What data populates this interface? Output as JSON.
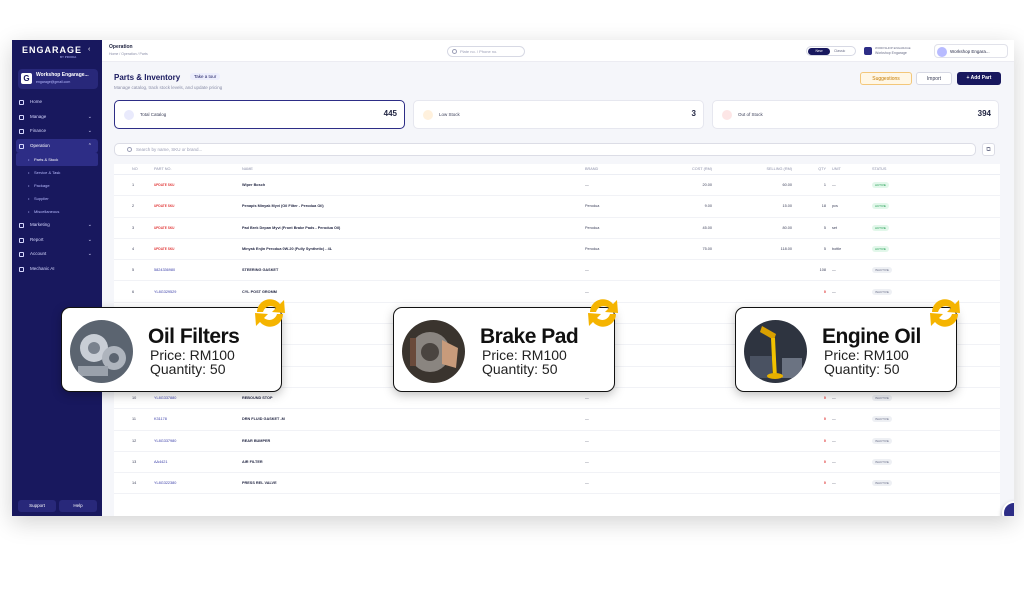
{
  "sidebar": {
    "logo": "ENGARAGE",
    "logo_sub": "BY PROIDA",
    "workshop_name": "Workshop Engarage...",
    "workshop_email": "engarage@gmail.com",
    "items": [
      {
        "label": "Home"
      },
      {
        "label": "Manage"
      },
      {
        "label": "Finance"
      },
      {
        "label": "Operation"
      },
      {
        "label": "Parts & Stock"
      },
      {
        "label": "Service & Task"
      },
      {
        "label": "Package"
      },
      {
        "label": "Supplier"
      },
      {
        "label": "Miscellaneous"
      },
      {
        "label": "Marketing"
      },
      {
        "label": "Report"
      },
      {
        "label": "Account"
      },
      {
        "label": "Mechanic AI"
      }
    ],
    "support": "Support",
    "help": "Help"
  },
  "topbar": {
    "title": "Operation",
    "breadcrumb": "Home / Operation / Parts",
    "search_placeholder": "Plate no. / Phone no.",
    "toggle_new": "New",
    "toggle_classic": "Classic",
    "account_label": "WORKSHOP ENGARAGE",
    "account_sub": "Workshop Engarage",
    "user": "Workshop Engara..."
  },
  "page": {
    "title": "Parts & Inventory",
    "tour": "Take a tour",
    "subtitle": "Manage catalog, track stock levels, and update pricing",
    "suggestions": "Suggestions",
    "import": "Import",
    "add_part": "+ Add Part"
  },
  "stats": {
    "total_label": "Total Catalog",
    "total_value": "445",
    "low_label": "Low Stock",
    "low_value": "3",
    "out_label": "Out of Stock",
    "out_value": "394"
  },
  "search": {
    "placeholder": "Search by name, SKU or brand..."
  },
  "table": {
    "headers": {
      "no": "NO",
      "part": "PART NO.",
      "name": "NAME",
      "brand": "BRAND",
      "cost": "COST (RM)",
      "sell": "SELLING (RM)",
      "qty": "QTY",
      "unit": "UNIT",
      "status": "STATUS"
    },
    "rows": [
      {
        "no": "1",
        "part": "UPDATE SKU",
        "name": "Wiper Bosch",
        "brand": "—",
        "cost": "20.00",
        "sell": "60.00",
        "qty": "1",
        "unit": "—",
        "status": "ACTIVE"
      },
      {
        "no": "2",
        "part": "UPDATE SKU",
        "name": "Penapis Minyak Myvi (Oil Filter - Perodua Oil)",
        "brand": "Perodua",
        "cost": "9.00",
        "sell": "15.00",
        "qty": "18",
        "unit": "pcs",
        "status": "ACTIVE"
      },
      {
        "no": "3",
        "part": "UPDATE SKU",
        "name": "Pad Brek Depan Myvi (Front Brake Pads - Perodua Oil)",
        "brand": "Perodua",
        "cost": "45.00",
        "sell": "80.00",
        "qty": "5",
        "unit": "set",
        "status": "ACTIVE"
      },
      {
        "no": "4",
        "part": "UPDATE SKU",
        "name": "Minyak Enjin Perodua 0W-20 (Fully Synthetic) - 4L",
        "brand": "Perodua",
        "cost": "75.00",
        "sell": "118.00",
        "qty": "5",
        "unit": "bottle",
        "status": "ACTIVE"
      },
      {
        "no": "5",
        "part": "5824336980",
        "name": "STEERING GASKET",
        "brand": "—",
        "cost": "",
        "sell": "",
        "qty": "108",
        "unit": "—",
        "status": "INACTIVE"
      },
      {
        "no": "6",
        "part": "YL8G329529",
        "name": "CYL POST GROMM",
        "brand": "—",
        "cost": "",
        "sell": "",
        "qty": "0",
        "unit": "—",
        "status": "INACTIVE"
      },
      {
        "no": "",
        "part": "",
        "name": "",
        "brand": "",
        "cost": "",
        "sell": "",
        "qty": "",
        "unit": "",
        "status": ""
      },
      {
        "no": "",
        "part": "",
        "name": "",
        "brand": "",
        "cost": "",
        "sell": "",
        "qty": "",
        "unit": "",
        "status": ""
      },
      {
        "no": "",
        "part": "",
        "name": "",
        "brand": "",
        "cost": "",
        "sell": "",
        "qty": "",
        "unit": "",
        "status": ""
      },
      {
        "no": "9",
        "part": "336C73",
        "name": "VALVE PLG",
        "brand": "—",
        "cost": "",
        "sell": "",
        "qty": "0",
        "unit": "—",
        "status": "INACTIVE"
      },
      {
        "no": "10",
        "part": "YL8G337880",
        "name": "REBOUND STOP",
        "brand": "—",
        "cost": "",
        "sell": "",
        "qty": "0",
        "unit": "—",
        "status": "INACTIVE"
      },
      {
        "no": "11",
        "part": "K31178",
        "name": "DRN FLUID GASKET -M",
        "brand": "—",
        "cost": "",
        "sell": "",
        "qty": "0",
        "unit": "—",
        "status": "INACTIVE"
      },
      {
        "no": "12",
        "part": "YL8G337980",
        "name": "REAR BUMPER",
        "brand": "—",
        "cost": "",
        "sell": "",
        "qty": "0",
        "unit": "—",
        "status": "INACTIVE"
      },
      {
        "no": "13",
        "part": "AA4421",
        "name": "AIR FILTER",
        "brand": "—",
        "cost": "",
        "sell": "",
        "qty": "0",
        "unit": "—",
        "status": "INACTIVE"
      },
      {
        "no": "14",
        "part": "YL8G322380",
        "name": "PRESS REL VALVE",
        "brand": "—",
        "cost": "",
        "sell": "",
        "qty": "0",
        "unit": "—",
        "status": "INACTIVE"
      }
    ]
  },
  "cards": [
    {
      "name": "Oil Filters",
      "price": "Price: RM100",
      "quantity": "Quantity: 50"
    },
    {
      "name": "Brake Pad",
      "price": "Price: RM100",
      "quantity": "Quantity: 50"
    },
    {
      "name": "Engine Oil",
      "price": "Price: RM100",
      "quantity": "Quantity: 50"
    }
  ],
  "colors": {
    "brand": "#18185e",
    "accent": "#f5b400",
    "active": "#1c9a4e",
    "danger": "#e13a3a"
  }
}
